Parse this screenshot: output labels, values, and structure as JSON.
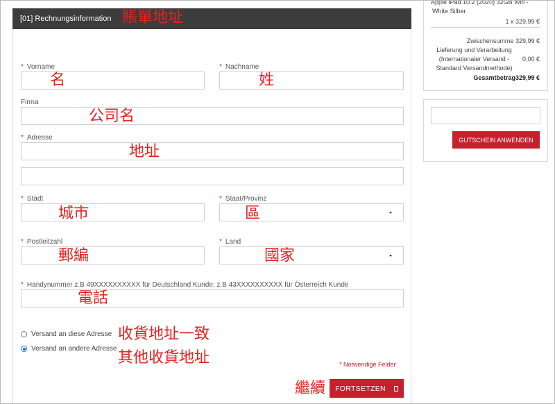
{
  "form": {
    "header_title": "[01] Rechnungsinformation",
    "required_mark": "*",
    "fields": {
      "first_name_label": "Vorname",
      "last_name_label": "Nachname",
      "company_label": "Firma",
      "address_label": "Adresse",
      "city_label": "Stadt",
      "state_label": "Staat/Provinz",
      "postal_label": "Postleitzahl",
      "country_label": "Land",
      "phone_label": "Handynummer z.B 49XXXXXXXXXX für Deutschland Kunde; z.B 43XXXXXXXXXX für Österreich Kunde"
    },
    "shipping_same_label": "Versand an diese Adresse",
    "shipping_other_label": "Versand an andere Adresse",
    "required_note": "* Notwendige Felder",
    "submit_label": "FORTSETZEN"
  },
  "annotations": {
    "billing_address": "賬單地址",
    "first_name": "名",
    "last_name": "姓",
    "company": "公司名",
    "address": "地址",
    "city": "城市",
    "district": "區",
    "postcode": "郵編",
    "country": "國家",
    "phone": "電話",
    "same_shipping": "收貨地址一致",
    "other_shipping": "其他收貨地址",
    "continue": "繼續"
  },
  "summary": {
    "product_name_line1": "Apple iPad 10.2 (2020) 32GB Wifi -",
    "product_name_line2": "White Silber",
    "product_qty_price": "1 x 329,99 €",
    "subtotal_label": "Zwischensumme",
    "subtotal_value": "329,99 €",
    "shipping_line1": "Lieferung und Verarbeitung",
    "shipping_line2": "(Internationaler Versand -",
    "shipping_line3": "Standard Versandmethode)",
    "shipping_value": "0,00 €",
    "total_label": "Gesamtbetrag",
    "total_value": "329,99 €"
  },
  "coupon": {
    "apply_label": "GUTSCHEIN ANWENDEN"
  },
  "colors": {
    "accent_red": "#c7202c",
    "header_dark": "#3c3c3c",
    "annotation_red": "#e8211e"
  }
}
